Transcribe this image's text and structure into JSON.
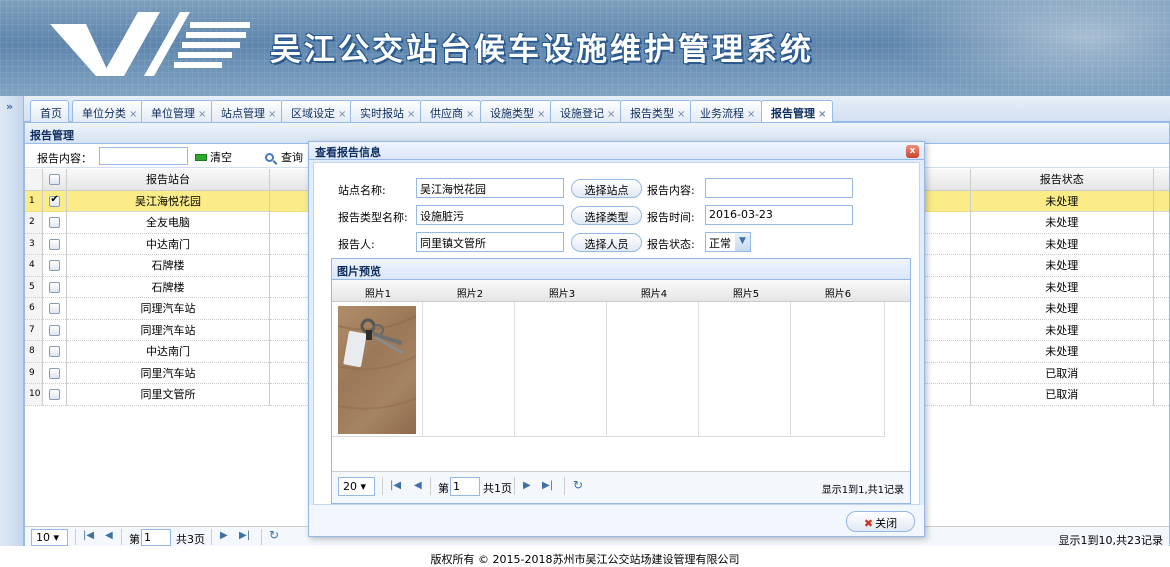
{
  "header": {
    "title": "吴江公交站台候车设施维护管理系统"
  },
  "nav_toggle": "»",
  "tabs": [
    {
      "label": "首页",
      "closable": false
    },
    {
      "label": "单位分类",
      "closable": true
    },
    {
      "label": "单位管理",
      "closable": true
    },
    {
      "label": "站点管理",
      "closable": true
    },
    {
      "label": "区域设定",
      "closable": true
    },
    {
      "label": "实时报站",
      "closable": true
    },
    {
      "label": "供应商",
      "closable": true
    },
    {
      "label": "设施类型",
      "closable": true
    },
    {
      "label": "设施登记",
      "closable": true
    },
    {
      "label": "报告类型",
      "closable": true
    },
    {
      "label": "业务流程",
      "closable": true
    },
    {
      "label": "报告管理",
      "closable": true,
      "active": true
    }
  ],
  "tab_close_glyph": "×",
  "panel": {
    "title": "报告管理",
    "search_label": "报告内容：",
    "clear_label": "清空",
    "query_label": "查询"
  },
  "grid": {
    "headers": {
      "site": "报告站台",
      "status": "报告状态"
    },
    "rows": [
      {
        "num": "1",
        "site": "吴江海悦花园",
        "status": "未处理",
        "checked": true
      },
      {
        "num": "2",
        "site": "全友电脑",
        "status": "未处理"
      },
      {
        "num": "3",
        "site": "中达南门",
        "status": "未处理"
      },
      {
        "num": "4",
        "site": "石牌楼",
        "status": "未处理"
      },
      {
        "num": "5",
        "site": "石牌楼",
        "status": "未处理"
      },
      {
        "num": "6",
        "site": "同理汽车站",
        "status": "未处理"
      },
      {
        "num": "7",
        "site": "同理汽车站",
        "status": "未处理"
      },
      {
        "num": "8",
        "site": "中达南门",
        "status": "未处理"
      },
      {
        "num": "9",
        "site": "同里汽车站",
        "status": "已取消"
      },
      {
        "num": "10",
        "site": "同里文管所",
        "status": "已取消"
      }
    ]
  },
  "pager": {
    "size": "10",
    "page_label": "第",
    "page": "1",
    "total_pages": "共3页",
    "info": "显示1到10,共23记录"
  },
  "dialog": {
    "title": "查看报告信息",
    "close_glyph": "x",
    "fields": {
      "site_label": "站点名称:",
      "site_value": "吴江海悦花园",
      "select_site": "选择站点",
      "content_label": "报告内容:",
      "content_value": "",
      "type_label": "报告类型名称:",
      "type_value": "设施脏污",
      "select_type": "选择类型",
      "time_label": "报告时间:",
      "time_value": "2016-03-23",
      "person_label": "报告人:",
      "person_value": "同里镇文管所",
      "select_person": "选择人员",
      "status_label": "报告状态:",
      "status_value": "正常"
    },
    "preview": {
      "title": "图片预览",
      "columns": [
        "照片1",
        "照片2",
        "照片3",
        "照片4",
        "照片5",
        "照片6"
      ],
      "pager": {
        "size": "20",
        "page_label": "第",
        "page": "1",
        "total_pages": "共1页",
        "info": "显示1到1,共1记录"
      }
    },
    "close_button": "关闭"
  },
  "footer": "版权所有 © 2015-2018苏州市吴江公交站场建设管理有限公司"
}
